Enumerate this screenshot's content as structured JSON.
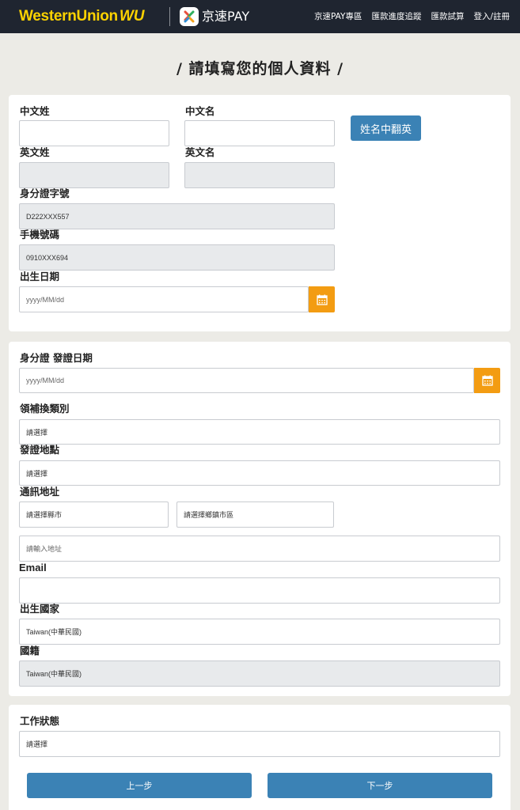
{
  "header": {
    "brand_text": "WesternUnion",
    "brand_mark": "WU",
    "partner_name": "京速PAY",
    "nav": [
      "京速PAY專區",
      "匯款進度追蹤",
      "匯款試算",
      "登入/註冊"
    ]
  },
  "page": {
    "title": "/ 請填寫您的個人資料 /"
  },
  "section1": {
    "chinese_surname_label": "中文姓",
    "chinese_given_label": "中文名",
    "translate_button": "姓名中翻英",
    "english_surname_label": "英文姓",
    "english_given_label": "英文名",
    "id_number_label": "身分證字號",
    "id_number_value": "D222XXX557",
    "mobile_label": "手機號碼",
    "mobile_value": "0910XXX694",
    "birthday_label": "出生日期",
    "birthday_placeholder": "yyyy/MM/dd"
  },
  "section2": {
    "id_issue_date_label": "身分證 發證日期",
    "id_issue_date_placeholder": "yyyy/MM/dd",
    "issue_type_label": "領補換類別",
    "issue_type_value": "請選擇",
    "issue_place_label": "發證地點",
    "issue_place_value": "請選擇",
    "address_label": "通訊地址",
    "city_value": "請選擇縣市",
    "district_value": "請選擇鄉鎮市區",
    "address_placeholder": "請輸入地址",
    "email_label": "Email",
    "birth_country_label": "出生國家",
    "birth_country_value": "Taiwan(中華民國)",
    "nationality_label": "國籍",
    "nationality_value": "Taiwan(中華民國)"
  },
  "section3": {
    "job_status_label": "工作狀態",
    "job_status_value": "請選擇",
    "prev_button": "上一步",
    "next_button": "下一步"
  },
  "colors": {
    "accent_orange": "#f39c12",
    "button_blue": "#3b82b5",
    "brand_yellow": "#fcd200",
    "header_bg": "#1f2530"
  },
  "icons": {
    "calendar": "calendar-icon",
    "partner_logo": "jingsu-logo-icon"
  }
}
